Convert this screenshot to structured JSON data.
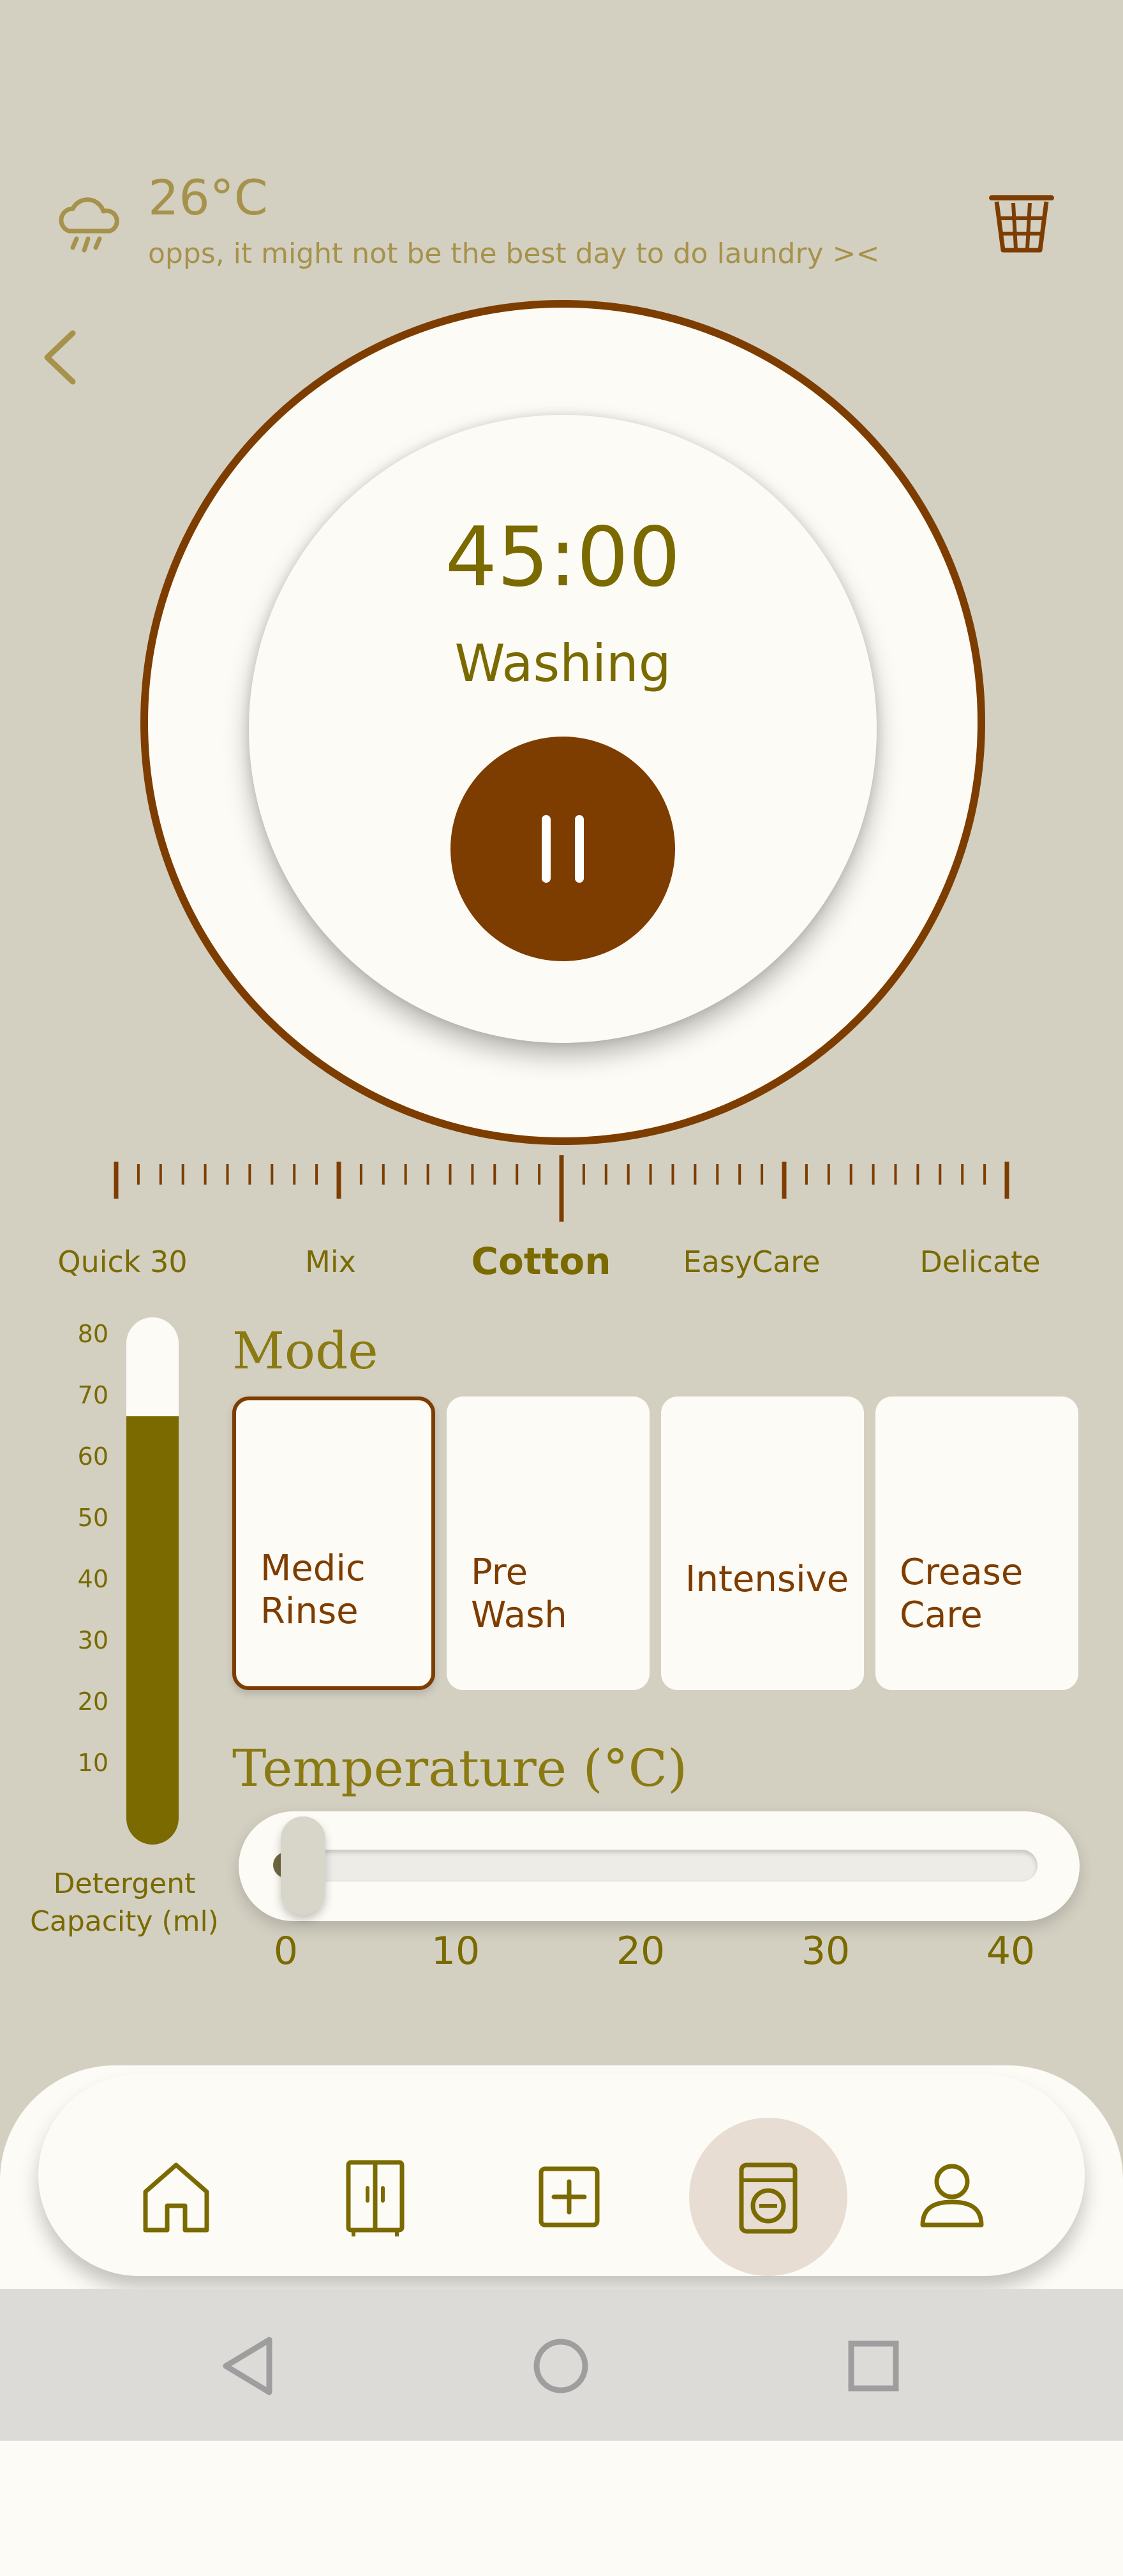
{
  "header": {
    "temperature": "26°C",
    "message": "opps, it might not be the best day to do laundry ><",
    "weather_icon": "cloud-rain-icon",
    "basket_icon": "laundry-basket-icon",
    "back_icon": "chevron-left-icon"
  },
  "dial": {
    "timer": "45:00",
    "status": "Washing",
    "pause_icon": "pause-icon"
  },
  "programs": {
    "items": [
      "Quick 30",
      "Mix",
      "Cotton",
      "EasyCare",
      "Delicate"
    ],
    "selected": "Cotton"
  },
  "detergent": {
    "scale": [
      "80",
      "70",
      "60",
      "50",
      "40",
      "30",
      "20",
      "10"
    ],
    "level_ml": 65,
    "max_ml": 80,
    "caption": "Detergent Capacity (ml)"
  },
  "mode": {
    "heading": "Mode",
    "cards": [
      {
        "label": "Medic\nRinse",
        "selected": true
      },
      {
        "label": "Pre\nWash",
        "selected": false
      },
      {
        "label": "Intensive",
        "selected": false
      },
      {
        "label": "Crease\nCare",
        "selected": false
      }
    ]
  },
  "temperature": {
    "heading": "Temperature (°C)",
    "ticks": [
      "0",
      "10",
      "20",
      "30",
      "40"
    ],
    "value": 0
  },
  "nav": {
    "items": [
      "home-icon",
      "wardrobe-icon",
      "add-icon",
      "washing-machine-icon",
      "profile-icon"
    ],
    "active": "washing-machine-icon"
  },
  "system": {
    "buttons": [
      "back-triangle-icon",
      "home-circle-icon",
      "recents-square-icon"
    ]
  },
  "colors": {
    "background": "#d3d0c2",
    "accent_brown": "#7e3d00",
    "olive": "#7a6a00",
    "card": "#fdfbf5"
  }
}
